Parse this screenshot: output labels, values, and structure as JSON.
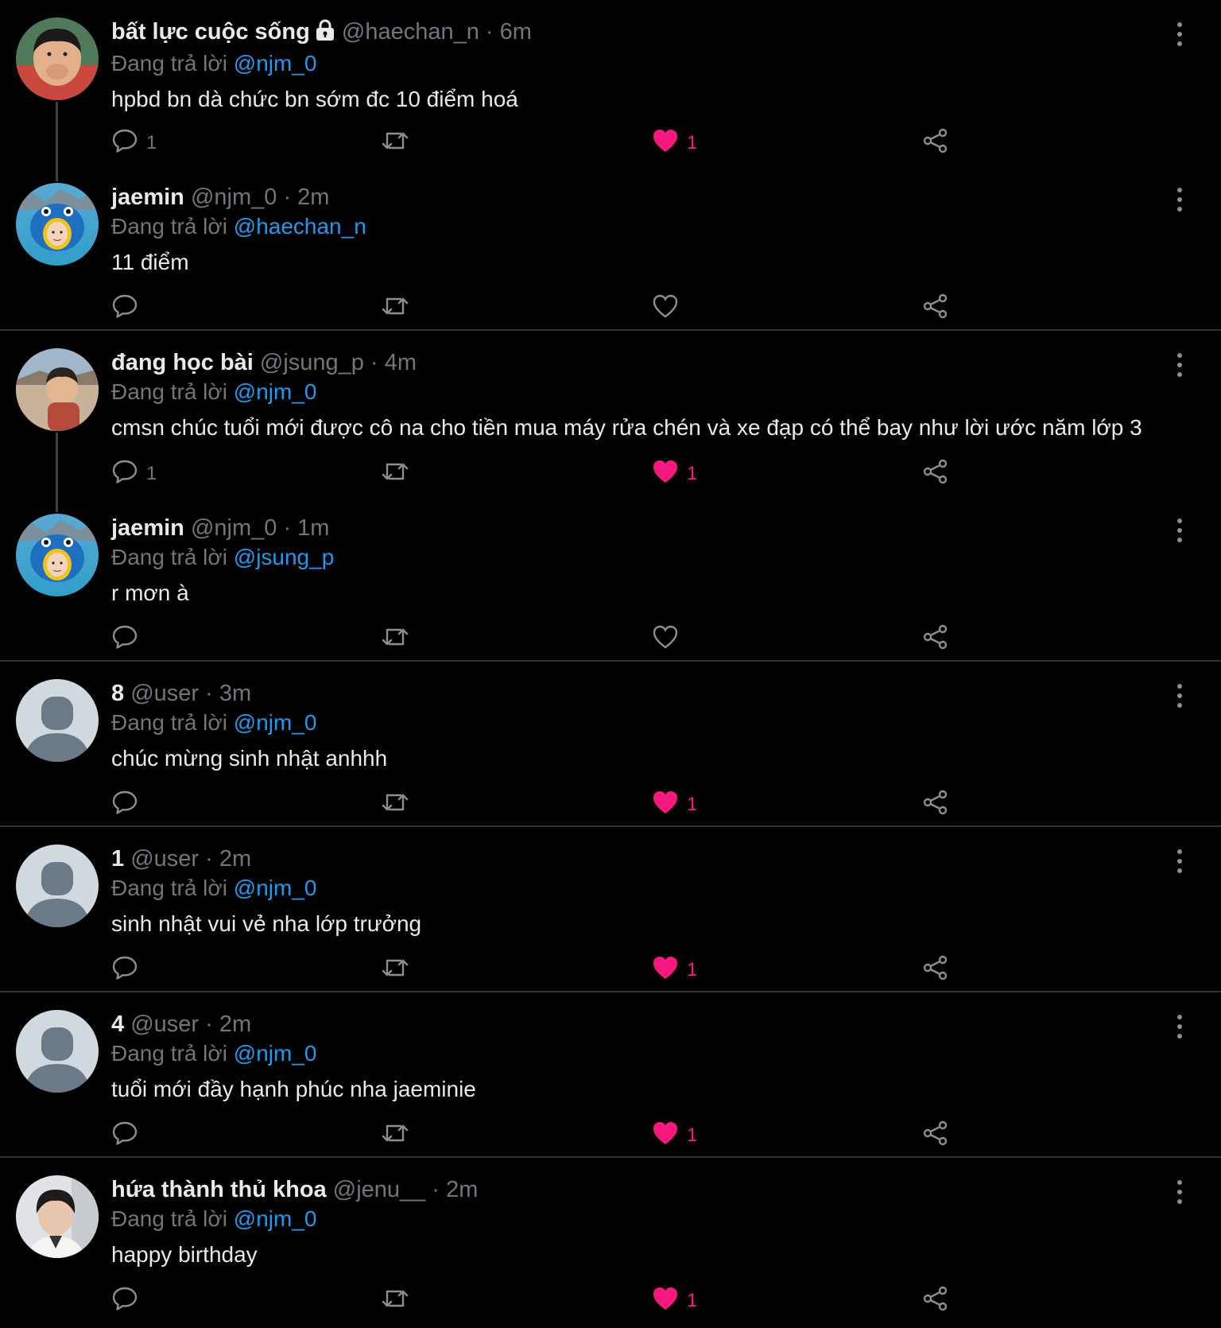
{
  "colors": {
    "background": "#000000",
    "text": "#e7e9ea",
    "muted": "#71767b",
    "link": "#1d9bf0",
    "like": "#f91880",
    "divider": "#2f3336"
  },
  "icons": {
    "reply": "speech-bubble-icon",
    "retweet": "retweet-icon",
    "like": "heart-icon",
    "share": "share-icon",
    "more": "more-vertical-icon",
    "lock": "lock-icon"
  },
  "tweets": [
    {
      "name": "bất lực cuộc sống",
      "locked": true,
      "handle": "@haechan_n",
      "dot": "·",
      "time": "6m",
      "reply_prefix": "Đang trả lời",
      "reply_to": "@njm_0",
      "text": "hpbd bn dà chức bn sớm đc 10 điểm hoá",
      "comments": "1",
      "likes": "1",
      "liked": true,
      "thread_next": true,
      "separator": false,
      "avatar": "photo-boy"
    },
    {
      "name": "jaemin",
      "locked": false,
      "handle": "@njm_0",
      "dot": "·",
      "time": "2m",
      "reply_prefix": "Đang trả lời",
      "reply_to": "@haechan_n",
      "text": "11 điểm",
      "comments": "",
      "likes": "",
      "liked": false,
      "thread_next": false,
      "separator": true,
      "avatar": "fish-costume"
    },
    {
      "name": "đang học bài",
      "locked": false,
      "handle": "@jsung_p",
      "dot": "·",
      "time": "4m",
      "reply_prefix": "Đang trả lời",
      "reply_to": "@njm_0",
      "text": "cmsn chúc tuổi mới được cô na cho tiền mua máy rửa chén và xe đạp có thể bay như lời ước năm lớp 3",
      "comments": "1",
      "likes": "1",
      "liked": true,
      "thread_next": true,
      "separator": false,
      "avatar": "photo-beach"
    },
    {
      "name": "jaemin",
      "locked": false,
      "handle": "@njm_0",
      "dot": "·",
      "time": "1m",
      "reply_prefix": "Đang trả lời",
      "reply_to": "@jsung_p",
      "text": "r mơn à",
      "comments": "",
      "likes": "",
      "liked": false,
      "thread_next": false,
      "separator": true,
      "avatar": "fish-costume"
    },
    {
      "name": "8",
      "locked": false,
      "handle": "@user",
      "dot": "·",
      "time": "3m",
      "reply_prefix": "Đang trả lời",
      "reply_to": "@njm_0",
      "text": "chúc mừng sinh nhật anhhh",
      "comments": "",
      "likes": "1",
      "liked": true,
      "thread_next": false,
      "separator": true,
      "avatar": "default"
    },
    {
      "name": "1",
      "locked": false,
      "handle": "@user",
      "dot": "·",
      "time": "2m",
      "reply_prefix": "Đang trả lời",
      "reply_to": "@njm_0",
      "text": "sinh nhật vui vẻ nha lớp trưởng",
      "comments": "",
      "likes": "1",
      "liked": true,
      "thread_next": false,
      "separator": true,
      "avatar": "default"
    },
    {
      "name": "4",
      "locked": false,
      "handle": "@user",
      "dot": "·",
      "time": "2m",
      "reply_prefix": "Đang trả lời",
      "reply_to": "@njm_0",
      "text": "tuổi mới đầy hạnh phúc nha jaeminie",
      "comments": "",
      "likes": "1",
      "liked": true,
      "thread_next": false,
      "separator": true,
      "avatar": "default"
    },
    {
      "name": "hứa thành thủ khoa",
      "locked": false,
      "handle": "@jenu__",
      "dot": "·",
      "time": "2m",
      "reply_prefix": "Đang trả lời",
      "reply_to": "@njm_0",
      "text": "happy birthday",
      "comments": "",
      "likes": "1",
      "liked": true,
      "thread_next": false,
      "separator": false,
      "avatar": "photo-portrait"
    }
  ]
}
